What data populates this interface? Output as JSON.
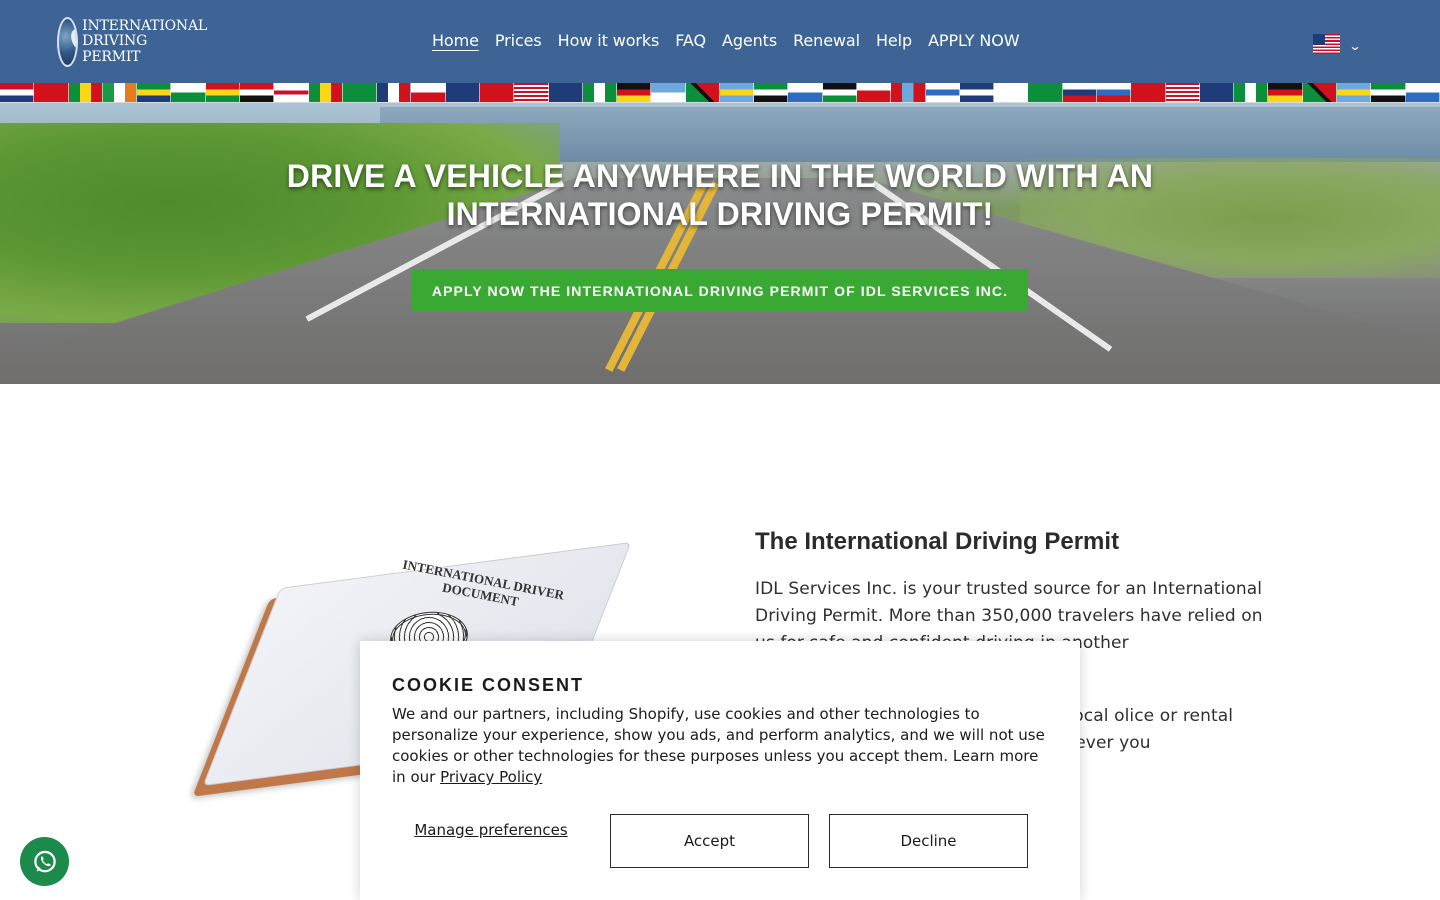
{
  "header": {
    "logo_lines": [
      "INTERNATIONAL",
      "DRIVING",
      "PERMIT"
    ],
    "nav": [
      {
        "label": "Home",
        "active": true
      },
      {
        "label": "Prices"
      },
      {
        "label": "How it works"
      },
      {
        "label": "FAQ"
      },
      {
        "label": "Agents"
      },
      {
        "label": "Renewal"
      },
      {
        "label": "Help"
      },
      {
        "label": "APPLY NOW"
      }
    ],
    "language": {
      "flag_icon": "us-flag-icon",
      "chevron_icon": "chevron-down-icon"
    }
  },
  "hero": {
    "title": "DRIVE A VEHICLE ANYWHERE IN THE WORLD WITH AN INTERNATIONAL DRIVING PERMIT!",
    "cta_label": "APPLY NOW THE INTERNATIONAL DRIVING PERMIT OF IDL SERVICES INC.",
    "cta_color": "#3aa934"
  },
  "content": {
    "permit_image": {
      "booklet_title": "INTERNATIONAL DRIVER DOCUMENT"
    },
    "title": "The International Driving Permit",
    "paragraph1": "IDL Services Inc. is your trusted source for an International Driving Permit. More than 350,000 travelers have relied on us for safe and confident driving in another",
    "paragraph2": "slation of your valid with ease, read local olice or rental staff s you peace of mind ready wherever you"
  },
  "cookie_consent": {
    "title": "COOKIE CONSENT",
    "text": "We and our partners, including Shopify, use cookies and other technologies to personalize your experience, show you ads, and perform analytics, and we will not use cookies or other technologies for these purposes unless you accept them. Learn more in our",
    "privacy_link": "Privacy Policy",
    "manage_label": "Manage preferences",
    "accept_label": "Accept",
    "decline_label": "Decline"
  },
  "colors": {
    "header_bg": "#3d6494",
    "cta_green": "#3aa934",
    "whatsapp_green": "#1b8a4a"
  },
  "floating": {
    "whatsapp_icon": "whatsapp-icon"
  }
}
